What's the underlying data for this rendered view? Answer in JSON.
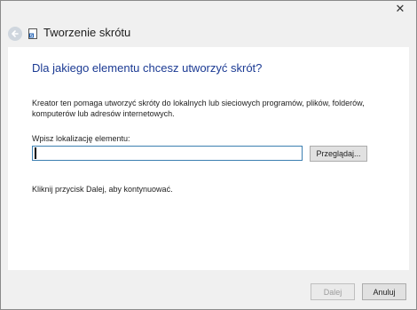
{
  "window": {
    "title": "Tworzenie skrótu",
    "close_glyph": "✕"
  },
  "wizard": {
    "heading": "Dla jakiego elementu chcesz utworzyć skrót?",
    "description": "Kreator ten pomaga utworzyć skróty do lokalnych lub sieciowych programów, plików, folderów, komputerów lub adresów internetowych.",
    "location_label": "Wpisz lokalizację elementu:",
    "location_value": "",
    "browse_label": "Przeglądaj...",
    "hint": "Kliknij przycisk Dalej, aby kontynuować."
  },
  "footer": {
    "next_label": "Dalej",
    "cancel_label": "Anuluj"
  },
  "icons": {
    "back": "back-arrow-icon",
    "app": "shortcut-icon",
    "close": "close-icon"
  },
  "colors": {
    "heading": "#1b3a93",
    "input_border_focus": "#3c7fb1",
    "chrome_bg": "#f0f0f0"
  }
}
